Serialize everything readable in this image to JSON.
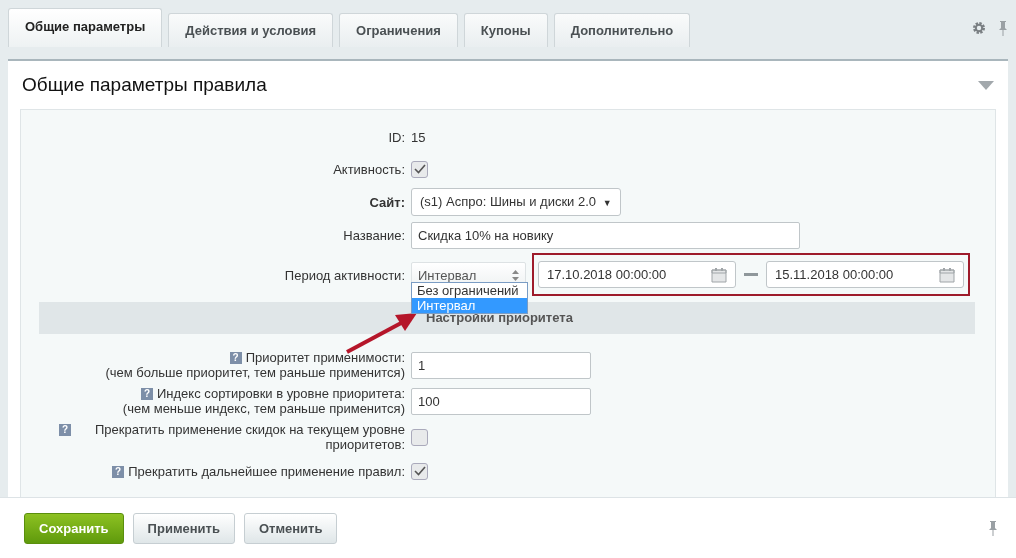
{
  "tabs": [
    {
      "label": "Общие параметры",
      "selected": true
    },
    {
      "label": "Действия и условия",
      "selected": false
    },
    {
      "label": "Ограничения",
      "selected": false
    },
    {
      "label": "Купоны",
      "selected": false
    },
    {
      "label": "Дополнительно",
      "selected": false
    }
  ],
  "panel": {
    "title": "Общие параметры правила",
    "expanded": true
  },
  "fields": [
    {
      "kind": "text",
      "label": "ID:",
      "value": "15"
    },
    {
      "kind": "checkbox",
      "label": "Активность:",
      "checked": true
    },
    {
      "kind": "select",
      "label": "Сайт:",
      "bold": true,
      "value": "(s1) Аспро: Шины и диски 2.0",
      "caret": "▼"
    },
    {
      "kind": "input",
      "label": "Название:",
      "value": "Скидка 10% на новику"
    },
    {
      "kind": "period",
      "label": "Период активности:",
      "value": "Интервал",
      "options": [
        {
          "label": "Без ограничений",
          "selected": false
        },
        {
          "label": "Интервал",
          "selected": true
        }
      ],
      "from": "17.10.2018 00:00:00",
      "to": "15.11.2018 00:00:00"
    },
    {
      "kind": "section",
      "label": "Настройки приоритета"
    },
    {
      "kind": "number",
      "label": "Приоритет применимости:",
      "hint": "(чем больше приоритет, тем раньше применится)",
      "help": "?",
      "value": "1"
    },
    {
      "kind": "number",
      "label": "Индекс сортировки в уровне приоритета:",
      "hint": "(чем меньше индекс, тем раньше применится)",
      "help": "?",
      "value": "100"
    },
    {
      "kind": "checkbox",
      "label": "Прекратить применение скидок на текущем уровне приоритетов:",
      "help": "?",
      "checked": false
    },
    {
      "kind": "checkbox",
      "label": "Прекратить дальнейшее применение правил:",
      "help": "?",
      "checked": true
    }
  ],
  "buttons": [
    {
      "label": "Сохранить",
      "kind": "primary"
    },
    {
      "label": "Применить",
      "kind": "normal"
    },
    {
      "label": "Отменить",
      "kind": "normal"
    }
  ]
}
